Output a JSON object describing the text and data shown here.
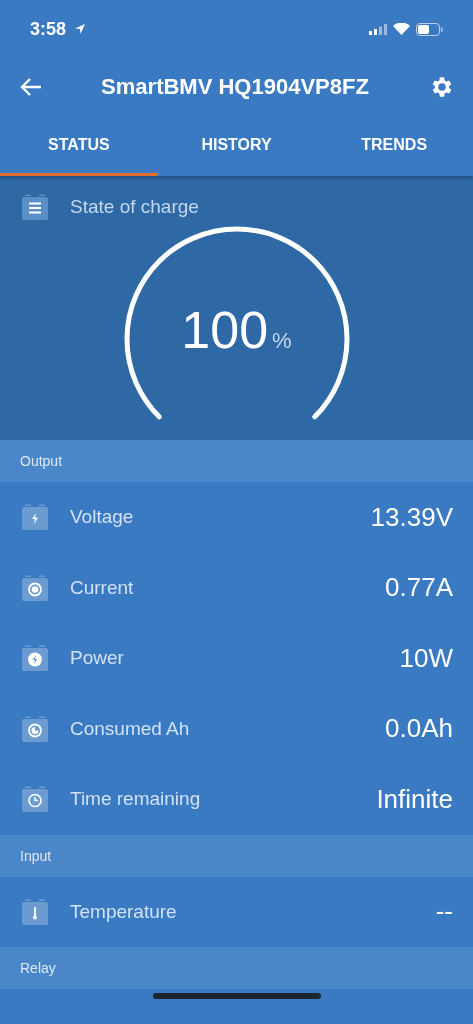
{
  "status_bar": {
    "time": "3:58"
  },
  "header": {
    "title": "SmartBMV HQ1904VP8FZ"
  },
  "tabs": [
    {
      "label": "STATUS",
      "selected": true
    },
    {
      "label": "HISTORY",
      "selected": false
    },
    {
      "label": "TRENDS",
      "selected": false
    }
  ],
  "state_of_charge": {
    "label": "State of charge",
    "value": "100",
    "unit": "%"
  },
  "sections": [
    {
      "title": "Output",
      "rows": [
        {
          "label": "Voltage",
          "value": "13.39V"
        },
        {
          "label": "Current",
          "value": "0.77A"
        },
        {
          "label": "Power",
          "value": "10W"
        },
        {
          "label": "Consumed Ah",
          "value": "0.0Ah"
        },
        {
          "label": "Time remaining",
          "value": "Infinite"
        }
      ]
    },
    {
      "title": "Input",
      "rows": [
        {
          "label": "Temperature",
          "value": "--"
        }
      ]
    },
    {
      "title": "Relay"
    }
  ]
}
